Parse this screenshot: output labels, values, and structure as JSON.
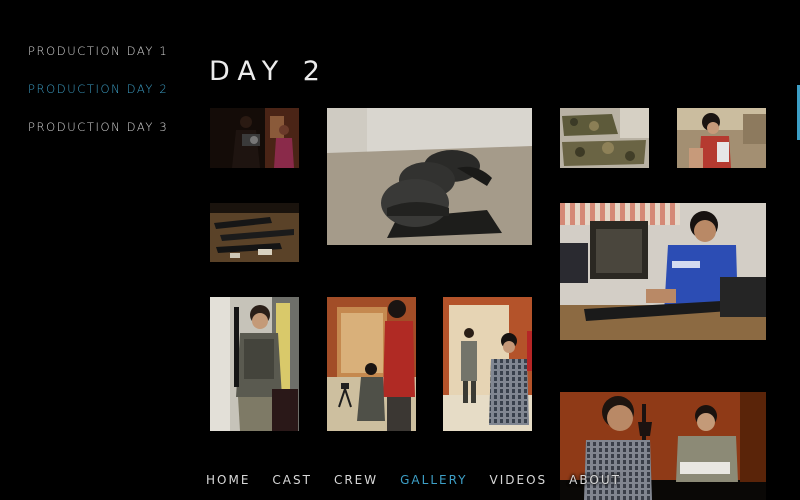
{
  "day_menu": {
    "items": [
      {
        "label": "PRODUCTION DAY 1",
        "active": false
      },
      {
        "label": "PRODUCTION DAY 2",
        "active": true
      },
      {
        "label": "PRODUCTION DAY 3",
        "active": false
      }
    ]
  },
  "title": "DAY 2",
  "gallery": {
    "photos": [
      {
        "subject": "camera-operator-photo"
      },
      {
        "subject": "helmets-on-floor-photo"
      },
      {
        "subject": "camouflage-gear-photo"
      },
      {
        "subject": "girl-preparing-props-photo"
      },
      {
        "subject": "prop-rifles-on-table-photo"
      },
      {
        "subject": "assembling-rifle-photo"
      },
      {
        "subject": "soldier-actor-photo"
      },
      {
        "subject": "crew-filming-photo"
      },
      {
        "subject": "actors-rehearsing-photo"
      },
      {
        "subject": "table-scene-photo"
      }
    ]
  },
  "bottom_nav": {
    "items": [
      {
        "label": "HOME",
        "active": false
      },
      {
        "label": "CAST",
        "active": false
      },
      {
        "label": "CREW",
        "active": false
      },
      {
        "label": "GALLERY",
        "active": true
      },
      {
        "label": "VIDEOS",
        "active": false
      },
      {
        "label": "ABOUT",
        "active": false
      }
    ]
  },
  "colors": {
    "background": "#000000",
    "text": "#d8d8d8",
    "accent": "#3d9fc6"
  }
}
